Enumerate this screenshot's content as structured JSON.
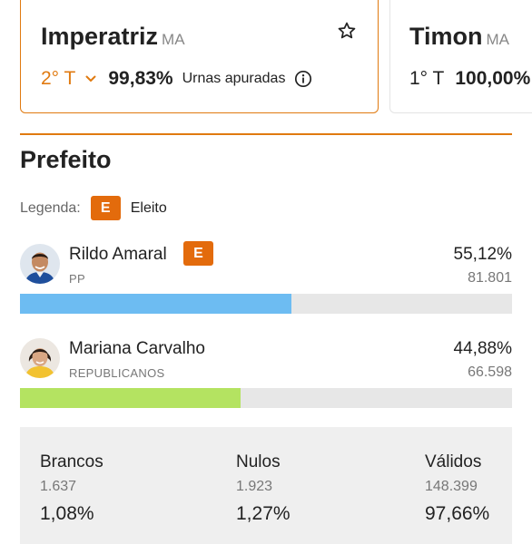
{
  "cities": [
    {
      "name": "Imperatriz",
      "state": "MA",
      "round": "2° T",
      "percent": "99,83%",
      "status": "Urnas apuradas",
      "favorite_icon": "star-outline-icon",
      "info_icon": "info-icon",
      "selected": true
    },
    {
      "name": "Timon",
      "state": "MA",
      "round": "1° T",
      "percent": "100,00%",
      "selected": false
    }
  ],
  "section": {
    "title": "Prefeito"
  },
  "legend": {
    "label": "Legenda:",
    "badge": "E",
    "text": "Eleito"
  },
  "candidates": [
    {
      "name": "Rildo Amaral",
      "party": "PP",
      "percent": "55,12%",
      "votes": "81.801",
      "elected_badge": "E",
      "share": 0.5512,
      "bar_color": "#6dbcf2"
    },
    {
      "name": "Mariana Carvalho",
      "party": "REPUBLICANOS",
      "percent": "44,88%",
      "votes": "66.598",
      "share": 0.4488,
      "bar_color": "#b4e361"
    }
  ],
  "summary": [
    {
      "label": "Brancos",
      "count": "1.637",
      "percent": "1,08%"
    },
    {
      "label": "Nulos",
      "count": "1.923",
      "percent": "1,27%"
    },
    {
      "label": "Válidos",
      "count": "148.399",
      "percent": "97,66%"
    }
  ],
  "colors": {
    "accent": "#e07a10",
    "badge": "#e36b0c"
  }
}
